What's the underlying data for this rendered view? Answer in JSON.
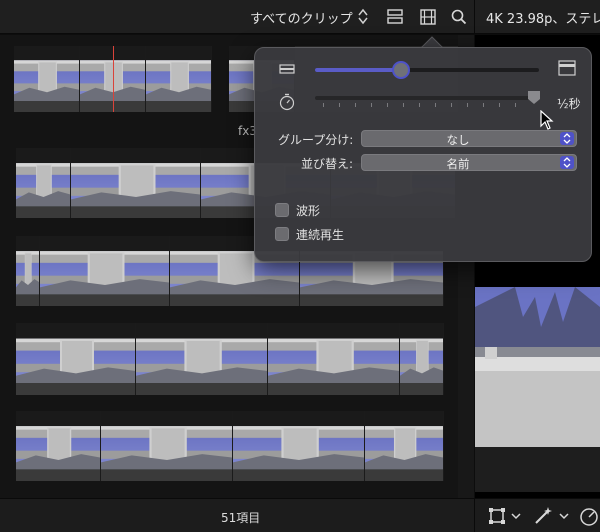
{
  "toolbar": {
    "clip_filter": "すべてのクリップ",
    "viewer_info": "4K 23.98p、ステレ"
  },
  "browser": {
    "clip_label": "fx3",
    "item_count": "51項目"
  },
  "appearance_popover": {
    "clip_height_level": 0.38,
    "duration_level": 0.98,
    "duration_value": "½秒",
    "group_by": {
      "label": "グループ分け:",
      "value": "なし"
    },
    "sort_by": {
      "label": "並び替え:",
      "value": "名前"
    },
    "waveforms": {
      "label": "波形",
      "checked": false
    },
    "continuous_playback": {
      "label": "連続再生",
      "checked": false
    }
  },
  "colors": {
    "accent": "#4d52c9",
    "playhead": "#d9433a"
  },
  "icons": [
    "updown-arrows-icon",
    "clip-appearance-icon",
    "filmstrip-icon",
    "search-icon",
    "small-clip-icon",
    "large-clip-icon",
    "stopwatch-icon",
    "transform-icon",
    "magic-wand-icon",
    "speed-icon",
    "cursor-icon"
  ]
}
